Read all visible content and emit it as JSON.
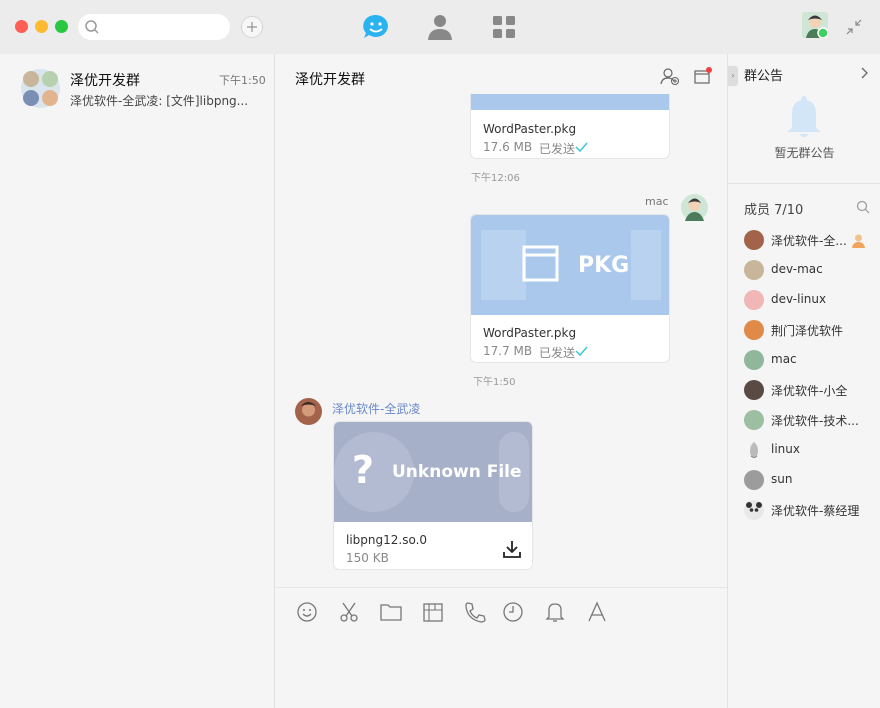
{
  "window": {
    "controls": [
      "close",
      "minimize",
      "zoom"
    ]
  },
  "search": {
    "placeholder": ""
  },
  "nav": {
    "items": [
      "chat-icon",
      "contacts-icon",
      "apps-icon"
    ],
    "active": "chat-icon"
  },
  "conversations": [
    {
      "title": "泽优开发群",
      "time": "下午1:50",
      "preview": "泽优软件-全武凌: [文件]libpng..."
    }
  ],
  "chat": {
    "title": "泽优开发群",
    "messages": [
      {
        "file_name": "WordPaster.pkg",
        "size": "17.6 MB",
        "status": "已发送"
      },
      {
        "timestamp": "下午12:06"
      },
      {
        "sender": "mac",
        "file_name": "WordPaster.pkg",
        "size": "17.7 MB",
        "status": "已发送",
        "preview_label": "PKG"
      },
      {
        "timestamp": "下午1:50"
      },
      {
        "sender": "泽优软件-全武凌",
        "file_name": "libpng12.so.0",
        "size": "150 KB",
        "preview_label": "Unknown File"
      }
    ],
    "toolbar": [
      "emoji-icon",
      "scissors-icon",
      "folder-icon",
      "screenshot-icon",
      "phone-icon",
      "clock-icon",
      "bell-icon",
      "font-icon"
    ]
  },
  "announcement": {
    "title": "群公告",
    "empty_text": "暂无群公告"
  },
  "members": {
    "header": "成员 7/10",
    "list": [
      {
        "name": "泽优软件-全...",
        "owner_badge": true
      },
      {
        "name": "dev-mac"
      },
      {
        "name": "dev-linux"
      },
      {
        "name": "荆门泽优软件"
      },
      {
        "name": "mac"
      },
      {
        "name": "泽优软件-小全"
      },
      {
        "name": "泽优软件-技术..."
      },
      {
        "name": "linux"
      },
      {
        "name": "sun"
      },
      {
        "name": "泽优软件-蔡经理"
      }
    ]
  },
  "colors": {
    "accent": "#2bb3f0",
    "sent_check": "#3ac8d8",
    "online": "#3ed062"
  }
}
